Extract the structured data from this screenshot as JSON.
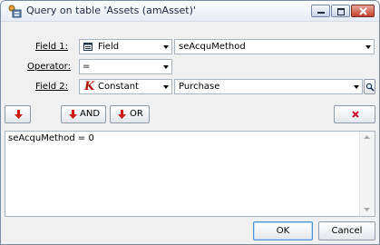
{
  "window": {
    "title": "Query on table 'Assets (amAsset)'"
  },
  "form": {
    "field1": {
      "label": "Field 1:",
      "type_value": "Field",
      "value": "seAcquMethod"
    },
    "operator": {
      "label": "Operator:",
      "value": "="
    },
    "field2": {
      "label": "Field 2:",
      "type_value": "Constant",
      "type_icon_glyph": "K",
      "value": "Purchase"
    }
  },
  "toolbar": {
    "and_label": "AND",
    "or_label": "OR"
  },
  "query_text": "seAcquMethod = 0",
  "buttons": {
    "ok_label": "OK",
    "cancel_label": "Cancel"
  },
  "colors": {
    "arrow_red": "#cc1b12",
    "delete_red": "#c8102e",
    "constant_k": "#b0120a"
  },
  "icons": {
    "title": "query-app-icon",
    "field_type": "field-icon",
    "constant_type": "constant-k-icon",
    "field2_helper": "magnifier-icon",
    "insert": "arrow-down-icon",
    "delete": "delete-x-icon"
  }
}
